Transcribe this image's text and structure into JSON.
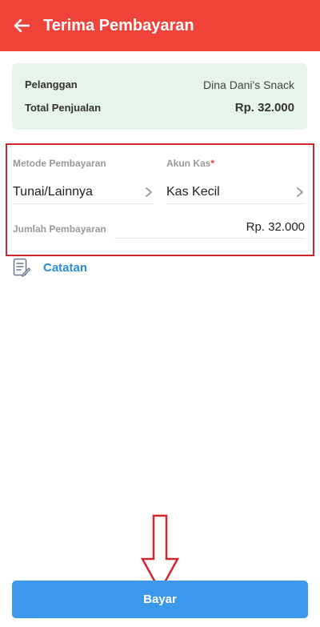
{
  "appbar": {
    "title": "Terima Pembayaran"
  },
  "summary": {
    "customer_label": "Pelanggan",
    "customer_value": "Dina Dani's Snack",
    "total_label": "Total Penjualan",
    "total_value": "Rp. 32.000"
  },
  "payment": {
    "method_label": "Metode Pembayaran",
    "method_value": "Tunai/Lainnya",
    "cash_account_label": "Akun Kas",
    "required_mark": "*",
    "cash_account_value": "Kas Kecil",
    "amount_label": "Jumlah Pembayaran",
    "amount_value": "Rp. 32.000"
  },
  "notes": {
    "label": "Catatan",
    "icon": "note-edit-icon"
  },
  "footer": {
    "pay_label": "Bayar"
  },
  "colors": {
    "appbar": "#f0443a",
    "summary_bg": "#e7f4ea",
    "highlight_border": "#d4262e",
    "link": "#2a8bd6",
    "button": "#3c98ea"
  }
}
